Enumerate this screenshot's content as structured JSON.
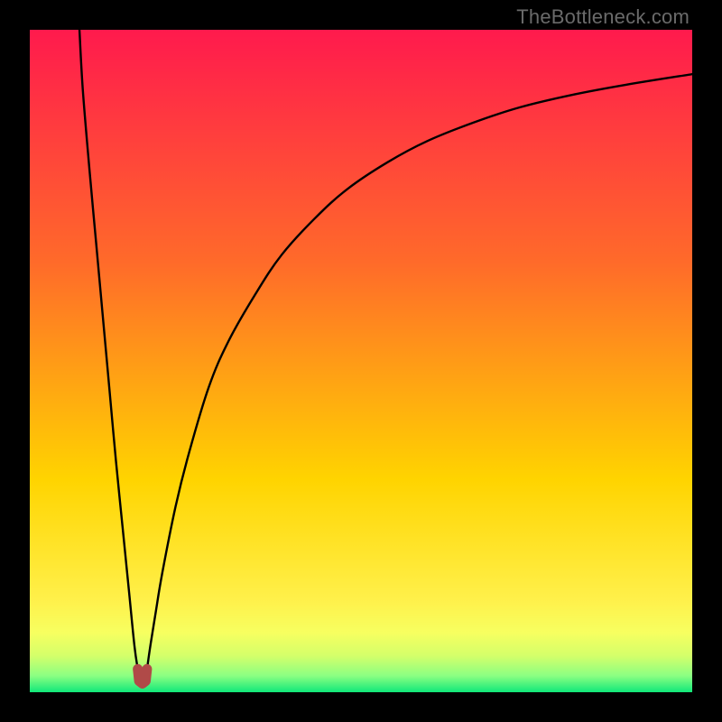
{
  "watermark": "TheBottleneck.com",
  "colors": {
    "top": "#ff1a4d",
    "mid1": "#ff6a2a",
    "mid2": "#ffd400",
    "band1": "#fff04a",
    "band2": "#f7ff60",
    "band3": "#d4ff6a",
    "band4": "#8cff82",
    "bottom": "#10e87a",
    "curve": "#000000",
    "marker": "#b04a48",
    "frame": "#000000"
  },
  "chart_data": {
    "type": "line",
    "title": "",
    "xlabel": "",
    "ylabel": "",
    "xlim": [
      0,
      100
    ],
    "ylim": [
      0,
      100
    ],
    "notch_x": 17,
    "series": [
      {
        "name": "left-branch",
        "x": [
          7.5,
          8,
          9,
          10,
          11,
          12,
          13,
          14,
          15,
          15.8,
          16.3
        ],
        "y": [
          100,
          91,
          79,
          68,
          57,
          46,
          35,
          25,
          15,
          7,
          3.5
        ]
      },
      {
        "name": "right-branch",
        "x": [
          17.7,
          18.2,
          19,
          20,
          22,
          24,
          27,
          30,
          34,
          38,
          43,
          48,
          54,
          60,
          67,
          74,
          82,
          90,
          100
        ],
        "y": [
          3.5,
          7,
          12,
          18,
          28,
          36,
          46,
          53,
          60,
          66,
          71.5,
          76,
          80,
          83.2,
          86,
          88.3,
          90.2,
          91.7,
          93.3
        ]
      },
      {
        "name": "notch-marker",
        "x": [
          16.3,
          16.5,
          17,
          17.5,
          17.7
        ],
        "y": [
          3.5,
          1.7,
          1.3,
          1.7,
          3.5
        ]
      }
    ]
  }
}
